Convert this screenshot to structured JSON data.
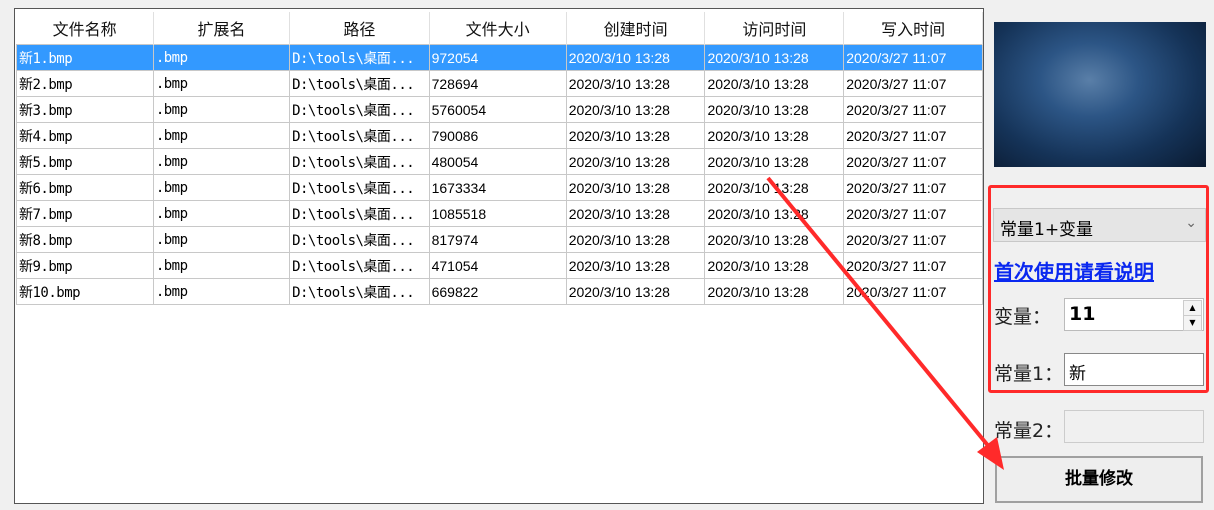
{
  "table": {
    "headers": [
      "文件名称",
      "扩展名",
      "路径",
      "文件大小",
      "创建时间",
      "访问时间",
      "写入时间"
    ],
    "rows": [
      [
        "新1.bmp",
        ".bmp",
        "D:\\tools\\桌面...",
        "972054",
        "2020/3/10 13:28",
        "2020/3/10 13:28",
        "2020/3/27 11:07"
      ],
      [
        "新2.bmp",
        ".bmp",
        "D:\\tools\\桌面...",
        "728694",
        "2020/3/10 13:28",
        "2020/3/10 13:28",
        "2020/3/27 11:07"
      ],
      [
        "新3.bmp",
        ".bmp",
        "D:\\tools\\桌面...",
        "5760054",
        "2020/3/10 13:28",
        "2020/3/10 13:28",
        "2020/3/27 11:07"
      ],
      [
        "新4.bmp",
        ".bmp",
        "D:\\tools\\桌面...",
        "790086",
        "2020/3/10 13:28",
        "2020/3/10 13:28",
        "2020/3/27 11:07"
      ],
      [
        "新5.bmp",
        ".bmp",
        "D:\\tools\\桌面...",
        "480054",
        "2020/3/10 13:28",
        "2020/3/10 13:28",
        "2020/3/27 11:07"
      ],
      [
        "新6.bmp",
        ".bmp",
        "D:\\tools\\桌面...",
        "1673334",
        "2020/3/10 13:28",
        "2020/3/10 13:28",
        "2020/3/27 11:07"
      ],
      [
        "新7.bmp",
        ".bmp",
        "D:\\tools\\桌面...",
        "1085518",
        "2020/3/10 13:28",
        "2020/3/10 13:28",
        "2020/3/27 11:07"
      ],
      [
        "新8.bmp",
        ".bmp",
        "D:\\tools\\桌面...",
        "817974",
        "2020/3/10 13:28",
        "2020/3/10 13:28",
        "2020/3/27 11:07"
      ],
      [
        "新9.bmp",
        ".bmp",
        "D:\\tools\\桌面...",
        "471054",
        "2020/3/10 13:28",
        "2020/3/10 13:28",
        "2020/3/27 11:07"
      ],
      [
        "新10.bmp",
        ".bmp",
        "D:\\tools\\桌面...",
        "669822",
        "2020/3/10 13:28",
        "2020/3/10 13:28",
        "2020/3/27 11:07"
      ]
    ]
  },
  "panel": {
    "mode_select": "常量1+变量",
    "help_link": "首次使用请看说明",
    "variable_label": "变量：",
    "variable_value": "11",
    "const1_label": "常量1：",
    "const1_value": "新",
    "const2_label": "常量2：",
    "const2_value": "",
    "batch_button": "批量修改"
  },
  "colors": {
    "selection": "#3399ff",
    "annotation": "#ff2a2a",
    "link": "#0a28f0"
  }
}
